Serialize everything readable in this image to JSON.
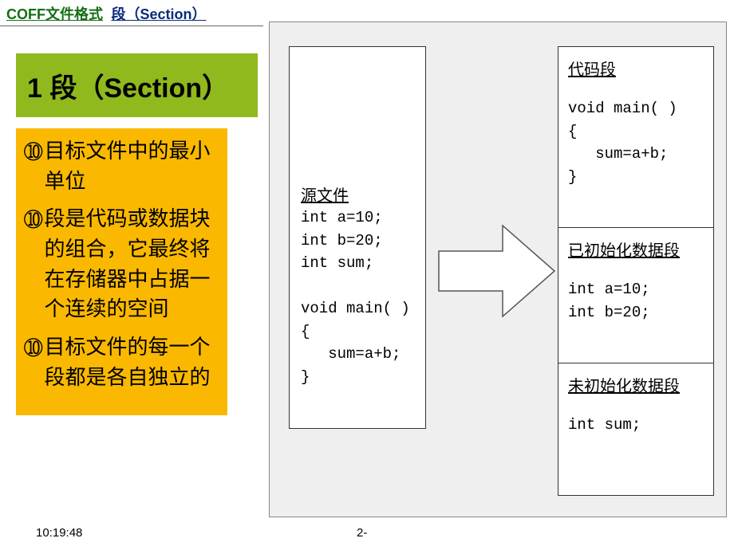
{
  "breadcrumb": {
    "part1": "COFF文件格式",
    "part2": "段（Section）"
  },
  "title": "1 段（Section）",
  "bullets": [
    "目标文件中的最小单位",
    "段是代码或数据块的组合，它最终将在存储器中占据一个连续的空间",
    "目标文件的每一个段都是各自独立的"
  ],
  "diagram": {
    "source_title": "源文件",
    "source_code": "int a=10;\nint b=20;\nint sum;\n\nvoid main( )\n{\n   sum=a+b;\n}",
    "code_title": "代码段",
    "code_body": "void main( )\n{\n   sum=a+b;\n}",
    "init_title": "已初始化数据段",
    "init_body": "int a=10;\nint b=20;",
    "uninit_title": "未初始化数据段",
    "uninit_body": "int sum;"
  },
  "footer": {
    "time": "10:19:48",
    "page": "2-"
  }
}
